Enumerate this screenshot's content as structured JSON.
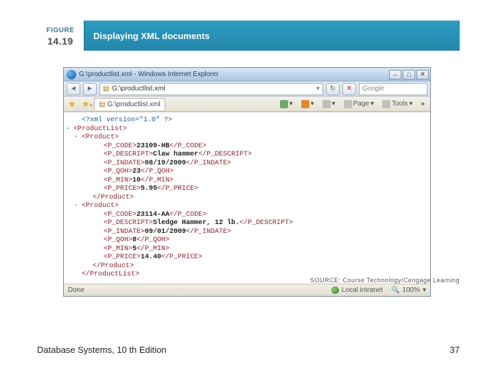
{
  "figure": {
    "label": "FIGURE",
    "number": "14.19",
    "title": "Displaying XML documents"
  },
  "browser": {
    "title": "G:\\productlist.xml - Windows Internet Explorer",
    "address": "G:\\productlist.xml",
    "search_placeholder": "Google",
    "tab_label": "G:\\productlist.xml",
    "toolbar": {
      "home": "",
      "feeds": "",
      "print": "",
      "page": "Page",
      "tools": "Tools"
    },
    "status": {
      "done": "Done",
      "zone": "Local intranet",
      "zoom": "100%"
    }
  },
  "xml": {
    "decl": "<?xml version=\"1.0\" ?>",
    "root_open": "<ProductList>",
    "root_close": "</ProductList>",
    "product_open": "<Product>",
    "product_close": "</Product>",
    "products": [
      {
        "P_CODE": "23109-HB",
        "P_DESCRIPT": "Claw hammer",
        "P_INDATE": "08/19/2009",
        "P_QOH": "23",
        "P_MIN": "10",
        "P_PRICE": "5.95"
      },
      {
        "P_CODE": "23114-AA",
        "P_DESCRIPT": "Sledge Hammer, 12 lb.",
        "P_INDATE": "09/01/2009",
        "P_QOH": "8",
        "P_MIN": "5",
        "P_PRICE": "14.40"
      }
    ],
    "tags": {
      "P_CODE_o": "<P_CODE>",
      "P_CODE_c": "</P_CODE>",
      "P_DESCRIPT_o": "<P_DESCRIPT>",
      "P_DESCRIPT_c": "</P_DESCRIPT>",
      "P_INDATE_o": "<P_INDATE>",
      "P_INDATE_c": "</P_INDATE>",
      "P_QOH_o": "<P_QOH>",
      "P_QOH_c": "</P_QOH>",
      "P_MIN_o": "<P_MIN>",
      "P_MIN_c": "</P_MIN>",
      "P_PRICE_o": "<P_PRICE>",
      "P_PRICE_c": "</P_PRICE>"
    }
  },
  "credit": "SOURCE: Course Technology/Cengage Learning",
  "footer": {
    "book": "Database Systems, 10 th Edition",
    "page": "37"
  }
}
